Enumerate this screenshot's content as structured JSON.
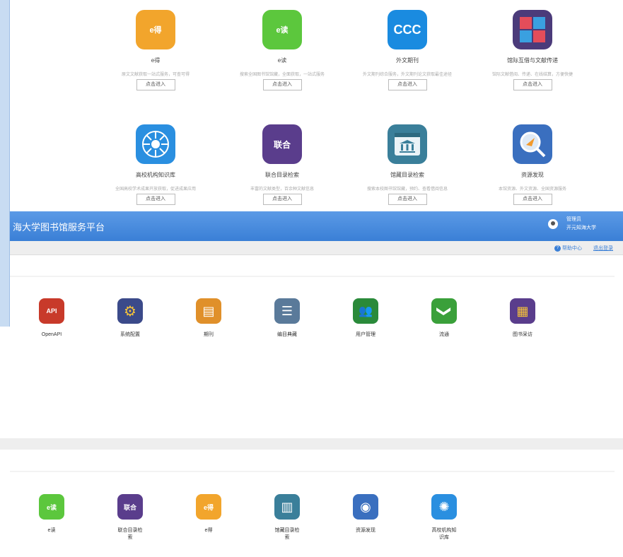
{
  "top_cards": [
    {
      "title": "e得",
      "desc": "原文文献获取一站式服务，可查可得",
      "button": "点击进入",
      "icon": "e-de-icon",
      "glyph": "e得",
      "color": "#f2a52c"
    },
    {
      "title": "e读",
      "desc": "搜索全国图书馆馆藏，全面获取，一站式服务",
      "button": "点击进入",
      "icon": "e-du-icon",
      "glyph": "e读",
      "color": "#5cc73d"
    },
    {
      "title": "外文期刊",
      "desc": "外文期刊综合服务，外文期刊论文获取最佳途径",
      "button": "点击进入",
      "icon": "ccc-icon",
      "glyph": "CCC",
      "color": "#1a8be0"
    },
    {
      "title": "馆际互借与文献传递",
      "desc": "馆际文献借阅、传递、在线结算，方便快捷",
      "button": "点击进入",
      "icon": "ill-icon",
      "glyph": "",
      "color": "#4b3b7a"
    },
    {
      "title": "高校机构知识库",
      "desc": "全国高校学术成果开放获取，促进成果应用",
      "button": "点击进入",
      "icon": "institutional-repository-icon",
      "glyph": "",
      "color": "#2a8fe0"
    },
    {
      "title": "联合目录检索",
      "desc": "丰富的文献类型，百余种文献信息",
      "button": "点击进入",
      "icon": "union-catalog-icon",
      "glyph": "联合",
      "color": "#5a3d8c"
    },
    {
      "title": "馆藏目录检索",
      "desc": "搜索本校图书馆馆藏，预约、查看借阅信息",
      "button": "点击进入",
      "icon": "opac-icon",
      "glyph": "",
      "color": "#3a7f9a"
    },
    {
      "title": "资源发现",
      "desc": "本馆资源、外文资源、全国资源服务",
      "button": "点击进入",
      "icon": "discovery-icon",
      "glyph": "",
      "color": "#3a6fbf"
    }
  ],
  "header": {
    "title": "海大学图书馆服务平台",
    "user_name": "管理员",
    "org_name": "开元知海大学"
  },
  "subbar": {
    "help": "帮助中心",
    "logout": "退出登录"
  },
  "admin_modules": [
    {
      "label": "OpenAPI",
      "icon": "openapi-icon",
      "glyph": "API",
      "color": "#c83a2a"
    },
    {
      "label": "系统配置",
      "icon": "gear-icon",
      "glyph": "⚙",
      "color": "#3b4a8a"
    },
    {
      "label": "期刊",
      "icon": "journal-icon",
      "glyph": "▤",
      "color": "#e0902a"
    },
    {
      "label": "编目典藏",
      "icon": "catalog-icon",
      "glyph": "☰",
      "color": "#5a7a9a"
    },
    {
      "label": "用户管理",
      "icon": "users-icon",
      "glyph": "👥",
      "color": "#2a8a3a"
    },
    {
      "label": "流通",
      "icon": "circulation-icon",
      "glyph": "❯",
      "color": "#3aa03a"
    },
    {
      "label": "图书采访",
      "icon": "acquisition-icon",
      "glyph": "▦",
      "color": "#5a3d8c"
    }
  ],
  "app_modules": [
    {
      "label": "e读",
      "icon": "e-du-icon",
      "glyph": "e读",
      "color": "#5cc73d"
    },
    {
      "label": "联合目录检索",
      "icon": "union-catalog-icon",
      "glyph": "联合",
      "color": "#5a3d8c"
    },
    {
      "label": "e得",
      "icon": "e-de-icon",
      "glyph": "e得",
      "color": "#f2a52c"
    },
    {
      "label": "馆藏目录检索",
      "icon": "opac-icon",
      "glyph": "▥",
      "color": "#3a7f9a"
    },
    {
      "label": "资源发现",
      "icon": "discovery-icon",
      "glyph": "◉",
      "color": "#3a6fbf"
    },
    {
      "label": "高校机构知识库",
      "icon": "institutional-repository-icon",
      "glyph": "✺",
      "color": "#2a8fe0"
    }
  ]
}
